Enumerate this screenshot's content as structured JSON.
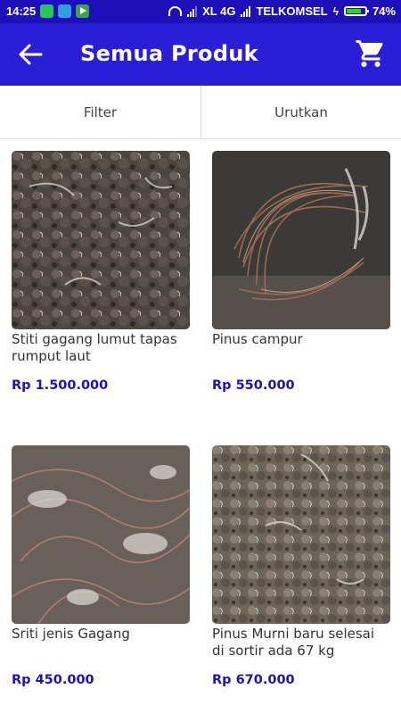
{
  "status_bar": {
    "time": "14:25",
    "network": "XL 4G",
    "carrier": "TELKOMSEL",
    "battery": "74%",
    "battery_level": 0.74
  },
  "app_bar": {
    "title": "Semua Produk",
    "back_icon": "arrow-back-icon",
    "cart_icon": "shopping-cart-icon",
    "background": "#2a1fd6"
  },
  "toolbar": {
    "filter_label": "Filter",
    "sort_label": "Urutkan"
  },
  "products": [
    {
      "name": "Stiti gagang lumut tapas rumput laut",
      "price": "Rp 1.500.000"
    },
    {
      "name": "Pinus campur",
      "price": "Rp 550.000"
    },
    {
      "name": "Sriti jenis Gagang",
      "price": "Rp 450.000"
    },
    {
      "name": "Pinus Murni baru selesai di sortir ada 67 kg",
      "price": "Rp 670.000"
    }
  ],
  "colors": {
    "status_bar": "#1e10b8",
    "price": "#1e13b5"
  }
}
